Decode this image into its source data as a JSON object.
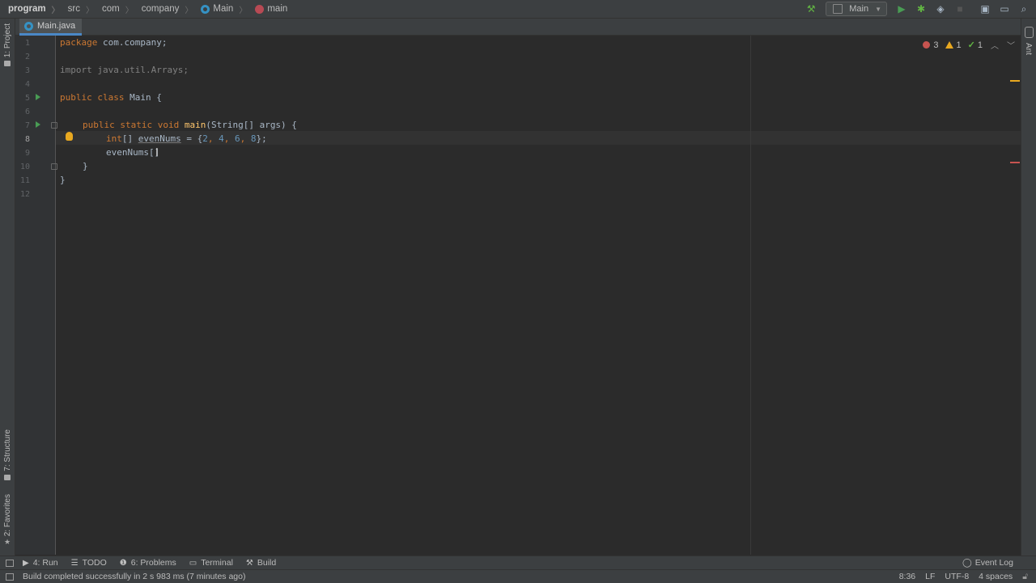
{
  "breadcrumb": {
    "project": "program",
    "src": "src",
    "com": "com",
    "company": "company",
    "class": "Main",
    "method": "main"
  },
  "toolbar": {
    "run_config": "Main",
    "icons": [
      "hammer-icon",
      "run-icon",
      "debug-icon",
      "coverage-icon",
      "stop-icon",
      "project-structure-icon",
      "window-icon",
      "search-icon"
    ]
  },
  "left_strip": {
    "project": "1: Project",
    "structure": "7: Structure",
    "favorites": "2: Favorites"
  },
  "right_strip": {
    "ant": "Ant"
  },
  "editor": {
    "tab": "Main.java",
    "line_numbers": [
      "1",
      "2",
      "3",
      "4",
      "5",
      "6",
      "7",
      "8",
      "9",
      "10",
      "11",
      "12"
    ],
    "active_line": 8,
    "lines": {
      "l1_kw": "package",
      "l1_rest": " com.company;",
      "l3": "import java.util.Arrays;",
      "l5_kw": "public class",
      "l5_rest": " Main {",
      "l7_kw": "public static void",
      "l7_fn": "main",
      "l7_rest": "(String[] args) {",
      "l8_kw": "int",
      "l8_a": "[] ",
      "l8_var": "evenNums",
      "l8_b": " = {",
      "l8_n1": "2",
      "l8_n2": "4",
      "l8_n3": "6",
      "l8_n4": "8",
      "l8_c": "};",
      "l9": "evenNums[]",
      "l10": "}",
      "l11": "}"
    }
  },
  "inspection": {
    "errors": "3",
    "warnings": "1",
    "ok": "1"
  },
  "bottom_tabs": {
    "run": "4: Run",
    "todo": "TODO",
    "problems": "6: Problems",
    "terminal": "Terminal",
    "build": "Build",
    "event_log": "Event Log"
  },
  "status": {
    "message": "Build completed successfully in 2 s 983 ms (7 minutes ago)",
    "position": "8:36",
    "line_sep": "LF",
    "encoding": "UTF-8",
    "indent": "4 spaces"
  },
  "colors": {
    "keyword": "#cc7832",
    "function": "#ffc66d",
    "number": "#6897bb",
    "run_green": "#499c54",
    "error": "#c75450",
    "warning": "#e8a820"
  }
}
